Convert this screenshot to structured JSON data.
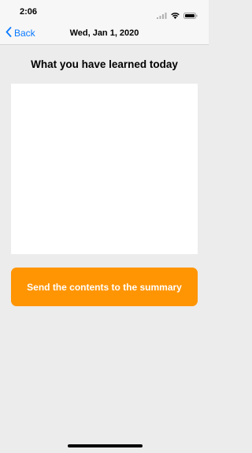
{
  "status_bar": {
    "time": "2:06",
    "icons": [
      "signal-icon",
      "wifi-icon",
      "battery-icon"
    ]
  },
  "nav_bar": {
    "back_label": "Back",
    "title": "Wed, Jan 1, 2020"
  },
  "main": {
    "heading": "What you have learned today",
    "text_input_value": "",
    "send_button_label": "Send the contents to the summary"
  },
  "colors": {
    "accent_blue": "#0a7aff",
    "button_orange": "#ff9503",
    "background": "#ececec",
    "bar_background": "#f7f7f7"
  }
}
